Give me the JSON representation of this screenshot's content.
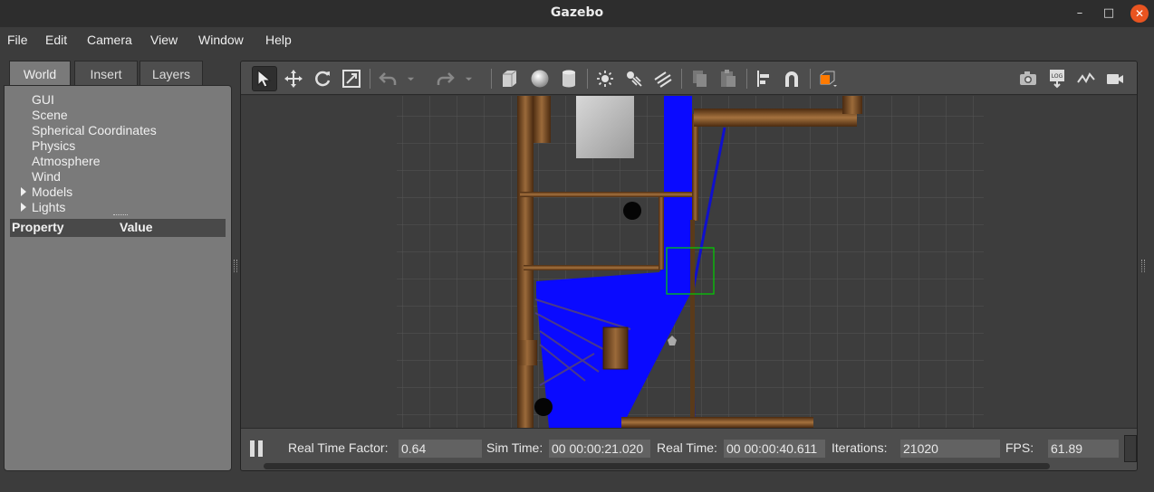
{
  "window": {
    "title": "Gazebo",
    "minimize": "–",
    "maximize": "□",
    "close": "✕"
  },
  "menu": [
    {
      "label": "File"
    },
    {
      "label": "Edit"
    },
    {
      "label": "Camera"
    },
    {
      "label": "View"
    },
    {
      "label": "Window"
    },
    {
      "label": "Help"
    }
  ],
  "left_panel": {
    "tabs": [
      "World",
      "Insert",
      "Layers"
    ],
    "active_tab": "World",
    "tree": [
      "GUI",
      "Scene",
      "Spherical Coordinates",
      "Physics",
      "Atmosphere",
      "Wind",
      "Models",
      "Lights"
    ],
    "expandable": [
      "Models",
      "Lights"
    ],
    "property_header": {
      "property": "Property",
      "value": "Value"
    }
  },
  "toolbar": {
    "tools": [
      {
        "name": "select-mode",
        "icon": "arrow-cursor-icon",
        "selected": true
      },
      {
        "name": "translate-mode",
        "icon": "move-arrows-icon"
      },
      {
        "name": "rotate-mode",
        "icon": "rotate-icon"
      },
      {
        "name": "scale-mode",
        "icon": "scale-icon"
      },
      {
        "name": "undo",
        "icon": "undo-icon"
      },
      {
        "name": "redo",
        "icon": "redo-icon"
      },
      {
        "name": "box",
        "icon": "box-icon"
      },
      {
        "name": "sphere",
        "icon": "sphere-icon"
      },
      {
        "name": "cylinder",
        "icon": "cylinder-icon"
      },
      {
        "name": "point-light",
        "icon": "point-light-icon"
      },
      {
        "name": "spot-light",
        "icon": "spot-light-icon"
      },
      {
        "name": "directional-light",
        "icon": "directional-light-icon"
      },
      {
        "name": "copy",
        "icon": "copy-icon"
      },
      {
        "name": "paste",
        "icon": "paste-icon"
      },
      {
        "name": "align",
        "icon": "align-icon"
      },
      {
        "name": "snap",
        "icon": "magnet-icon"
      },
      {
        "name": "view-angle",
        "icon": "view-cube-icon"
      },
      {
        "name": "screenshot",
        "icon": "camera-icon"
      },
      {
        "name": "log",
        "icon": "log-icon"
      },
      {
        "name": "plot",
        "icon": "plot-icon"
      },
      {
        "name": "video",
        "icon": "video-icon"
      }
    ],
    "log_text": "LOG"
  },
  "status": {
    "real_time_factor_label": "Real Time Factor:",
    "real_time_factor": "0.64",
    "sim_time_label": "Sim Time:",
    "sim_time": "00 00:00:21.020",
    "real_time_label": "Real Time:",
    "real_time": "00 00:00:40.611",
    "iterations_label": "Iterations:",
    "iterations": "21020",
    "fps_label": "FPS:",
    "fps": "61.89"
  },
  "colors": {
    "laser": "#0a0aff",
    "wood": "#7a4a1e",
    "selection": "#00d000",
    "close_button": "#e95420"
  }
}
